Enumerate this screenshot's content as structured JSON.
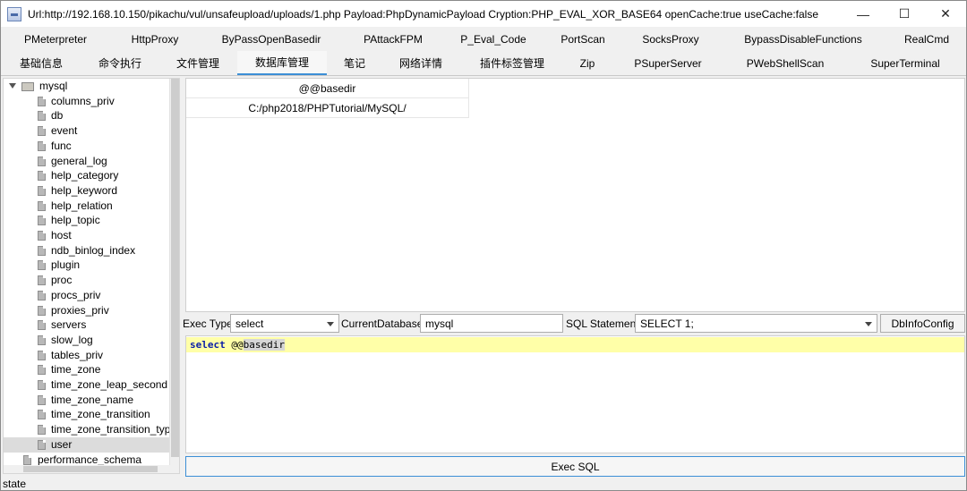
{
  "window": {
    "title": "Url:http://192.168.10.150/pikachu/vul/unsafeupload/uploads/1.php Payload:PhpDynamicPayload Cryption:PHP_EVAL_XOR_BASE64 openCache:true useCache:false",
    "minimize": "—",
    "maximize": "☐",
    "close": "✕"
  },
  "tabs_row1": [
    "PMeterpreter",
    "HttpProxy",
    "ByPassOpenBasedir",
    "PAttackFPM",
    "P_Eval_Code",
    "PortScan",
    "SocksProxy",
    "BypassDisableFunctions",
    "RealCmd"
  ],
  "tabs_row2": [
    "基础信息",
    "命令执行",
    "文件管理",
    "数据库管理",
    "笔记",
    "网络详情",
    "插件标签管理",
    "Zip",
    "PSuperServer",
    "PWebShellScan",
    "SuperTerminal"
  ],
  "active_tab": "数据库管理",
  "tree": {
    "root": "mysql",
    "children": [
      "columns_priv",
      "db",
      "event",
      "func",
      "general_log",
      "help_category",
      "help_keyword",
      "help_relation",
      "help_topic",
      "host",
      "ndb_binlog_index",
      "plugin",
      "proc",
      "procs_priv",
      "proxies_priv",
      "servers",
      "slow_log",
      "tables_priv",
      "time_zone",
      "time_zone_leap_second",
      "time_zone_name",
      "time_zone_transition",
      "time_zone_transition_type",
      "user"
    ],
    "selected": "user",
    "sibling": "performance_schema"
  },
  "result": {
    "header": "@@basedir",
    "rows": [
      "C:/php2018/PHPTutorial/MySQL/"
    ]
  },
  "controls": {
    "exec_type_label": "Exec Type",
    "exec_type_value": "select",
    "current_db_label": "CurrentDatabase",
    "current_db_value": "mysql",
    "sql_statement_label": "SQL Statement",
    "sql_statement_value": "SELECT 1;",
    "dbinfo_button": "DbInfoConfig"
  },
  "editor": {
    "keyword": "select",
    "space": " ",
    "at": "@@",
    "selected_text": "basedir"
  },
  "exec_button": "Exec SQL",
  "status": "state"
}
